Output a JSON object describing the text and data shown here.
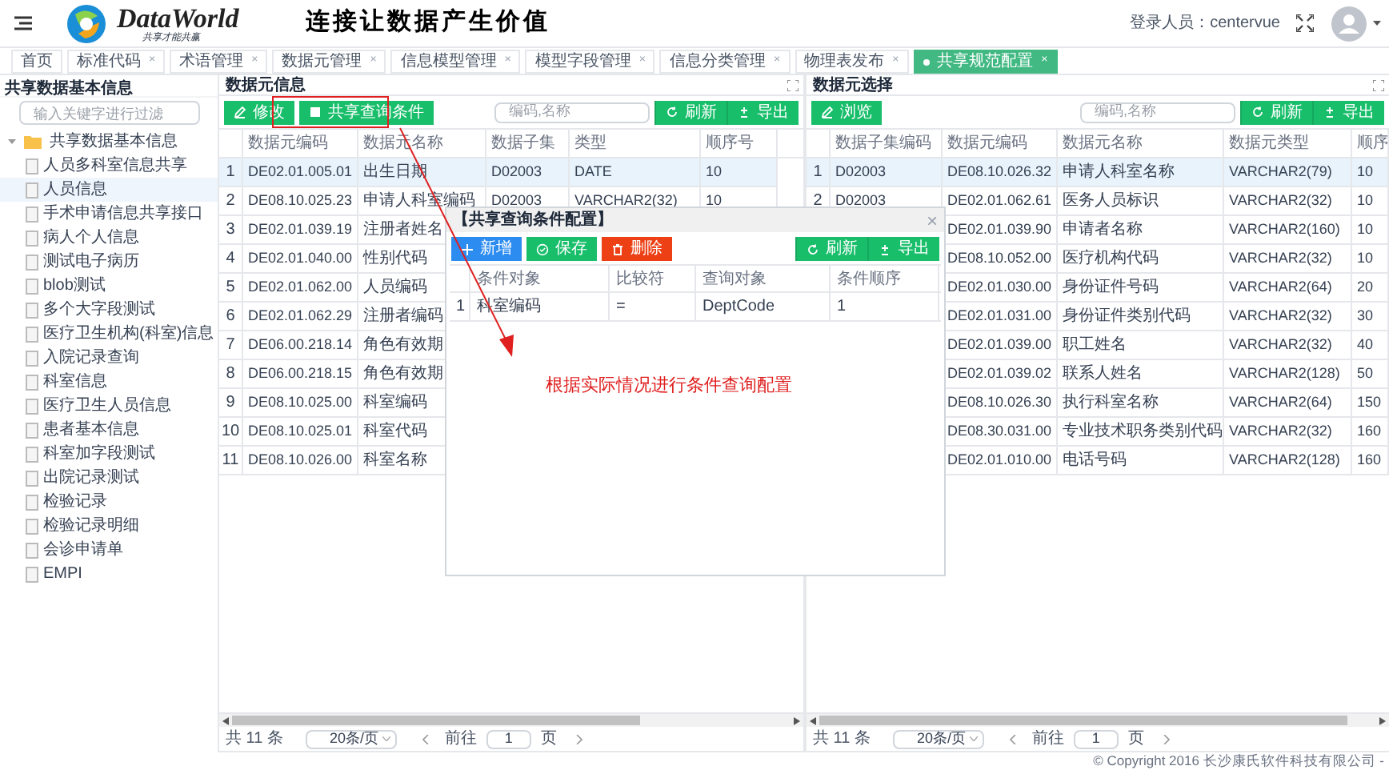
{
  "header": {
    "logo_text": "DataWorld",
    "logo_subtitle": "共享才能共赢",
    "slogan": "连接让数据产生价值",
    "login_label": "登录人员：centervue"
  },
  "tabs": [
    {
      "label": "首页",
      "selected": false
    },
    {
      "label": "标准代码",
      "close": "×",
      "selected": false
    },
    {
      "label": "术语管理",
      "close": "×",
      "selected": false
    },
    {
      "label": "数据元管理",
      "close": "×",
      "selected": false
    },
    {
      "label": "信息模型管理",
      "close": "×",
      "selected": false
    },
    {
      "label": "模型字段管理",
      "close": "×",
      "selected": false
    },
    {
      "label": "信息分类管理",
      "close": "×",
      "selected": false
    },
    {
      "label": "物理表发布",
      "close": "×",
      "selected": false
    },
    {
      "label": "共享规范配置",
      "close": "×",
      "selected": true
    }
  ],
  "sidebar": {
    "title": "共享数据基本信息",
    "filter_placeholder": "输入关键字进行过滤",
    "tree": [
      {
        "label": "共享数据基本信息",
        "expanded": true,
        "children": [
          {
            "label": "人员多科室信息共享",
            "selected": false
          },
          {
            "label": "人员信息",
            "selected": true
          },
          {
            "label": "手术申请信息共享接口",
            "selected": false
          },
          {
            "label": "病人个人信息",
            "selected": false
          },
          {
            "label": "测试电子病历",
            "selected": false
          },
          {
            "label": "blob测试",
            "selected": false
          },
          {
            "label": "多个大字段测试",
            "selected": false
          },
          {
            "label": "医疗卫生机构(科室)信息",
            "selected": false
          },
          {
            "label": "入院记录查询",
            "selected": false
          },
          {
            "label": "科室信息",
            "selected": false
          },
          {
            "label": "医疗卫生人员信息",
            "selected": false
          },
          {
            "label": "患者基本信息",
            "selected": false
          },
          {
            "label": "科室加字段测试",
            "selected": false
          },
          {
            "label": "出院记录测试",
            "selected": false
          },
          {
            "label": "检验记录",
            "selected": false
          },
          {
            "label": "检验记录明细",
            "selected": false
          },
          {
            "label": "会诊申请单",
            "selected": false
          },
          {
            "label": "EMPI",
            "selected": false
          }
        ]
      }
    ]
  },
  "panels": [
    {
      "title": "数据元信息",
      "buttons": [
        {
          "label": "修改",
          "kind": "edit"
        },
        {
          "label": "共享查询条件",
          "kind": "doc"
        }
      ],
      "search_placeholder": "编码,名称",
      "actions": [
        {
          "label": "刷新",
          "kind": "refresh"
        },
        {
          "label": "导出",
          "kind": "export"
        }
      ],
      "columns": [
        "数据元编码",
        "数据元名称",
        "数据子集",
        "类型",
        "顺序号"
      ],
      "rows": [
        {
          "selected": true,
          "number": "1",
          "cells": [
            "DE02.01.005.01",
            "出生日期",
            "D02003",
            "DATE",
            "10"
          ]
        },
        {
          "selected": false,
          "number": "2",
          "cells": [
            "DE08.10.025.23",
            "申请人科室编码",
            "D02003",
            "VARCHAR2(32)",
            "10"
          ]
        },
        {
          "selected": false,
          "number": "3",
          "cells": [
            "DE02.01.039.19",
            "注册者姓名"
          ]
        },
        {
          "selected": false,
          "number": "4",
          "cells": [
            "DE02.01.040.00",
            "性别代码"
          ]
        },
        {
          "selected": false,
          "number": "5",
          "cells": [
            "DE02.01.062.00",
            "人员编码"
          ]
        },
        {
          "selected": false,
          "number": "6",
          "cells": [
            "DE02.01.062.29",
            "注册者编码"
          ]
        },
        {
          "selected": false,
          "number": "7",
          "cells": [
            "DE06.00.218.14",
            "角色有效期"
          ]
        },
        {
          "selected": false,
          "number": "8",
          "cells": [
            "DE06.00.218.15",
            "角色有效期"
          ]
        },
        {
          "selected": false,
          "number": "9",
          "cells": [
            "DE08.10.025.00",
            "科室编码"
          ]
        },
        {
          "selected": false,
          "number": "10",
          "cells": [
            "DE08.10.025.01",
            "科室代码"
          ]
        },
        {
          "selected": false,
          "number": "11",
          "cells": [
            "DE08.10.026.00",
            "科室名称"
          ]
        }
      ],
      "pagination": {
        "total": "共 11 条",
        "page_size": "20条/页",
        "goto_label": "前往",
        "page": "1",
        "page_suffix": "页"
      }
    },
    {
      "title": "数据元选择",
      "buttons": [
        {
          "label": "浏览",
          "kind": "edit"
        }
      ],
      "search_placeholder": "编码,名称",
      "actions": [
        {
          "label": "刷新",
          "kind": "refresh"
        },
        {
          "label": "导出",
          "kind": "export"
        }
      ],
      "columns": [
        "数据子集编码",
        "数据元编码",
        "数据元名称",
        "数据元类型",
        "顺序"
      ],
      "rows": [
        {
          "selected": true,
          "number": "1",
          "cells": [
            "D02003",
            "DE08.10.026.32",
            "申请人科室名称",
            "VARCHAR2(79)",
            "10"
          ]
        },
        {
          "selected": false,
          "number": "2",
          "cells": [
            "D02003",
            "DE02.01.062.61",
            "医务人员标识",
            "VARCHAR2(32)",
            "10"
          ]
        },
        {
          "selected": false,
          "cells": [
            null,
            "DE02.01.039.90",
            "申请者名称",
            "VARCHAR2(160)",
            "10"
          ]
        },
        {
          "selected": false,
          "cells": [
            null,
            "DE08.10.052.00",
            "医疗机构代码",
            "VARCHAR2(32)",
            "10"
          ]
        },
        {
          "selected": false,
          "cells": [
            null,
            "DE02.01.030.00",
            "身份证件号码",
            "VARCHAR2(64)",
            "20"
          ]
        },
        {
          "selected": false,
          "cells": [
            null,
            "DE02.01.031.00",
            "身份证件类别代码",
            "VARCHAR2(32)",
            "30"
          ]
        },
        {
          "selected": false,
          "cells": [
            null,
            "DE02.01.039.00",
            "职工姓名",
            "VARCHAR2(32)",
            "40"
          ]
        },
        {
          "selected": false,
          "cells": [
            null,
            "DE02.01.039.02",
            "联系人姓名",
            "VARCHAR2(128)",
            "50"
          ]
        },
        {
          "selected": false,
          "cells": [
            null,
            "DE08.10.026.30",
            "执行科室名称",
            "VARCHAR2(64)",
            "150"
          ]
        },
        {
          "selected": false,
          "cells": [
            null,
            "DE08.30.031.00",
            "专业技术职务类别代码",
            "VARCHAR2(32)",
            "160"
          ]
        },
        {
          "selected": false,
          "cells": [
            null,
            "DE02.01.010.00",
            "电话号码",
            "VARCHAR2(128)",
            "160"
          ]
        }
      ],
      "pagination": {
        "total": "共 11 条",
        "page_size": "20条/页",
        "goto_label": "前往",
        "page": "1",
        "page_suffix": "页"
      }
    }
  ],
  "dialog": {
    "title": "【共享查询条件配置】",
    "close": "×",
    "buttons": [
      {
        "label": "新增",
        "kind": "add"
      },
      {
        "label": "保存",
        "kind": "save"
      },
      {
        "label": "删除",
        "kind": "delete"
      }
    ],
    "actions": [
      {
        "label": "刷新",
        "kind": "refresh"
      },
      {
        "label": "导出",
        "kind": "export"
      }
    ],
    "columns": [
      "条件对象",
      "比较符",
      "查询对象",
      "条件顺序"
    ],
    "rows": [
      {
        "number": "1",
        "cells": [
          "科室编码",
          "=",
          "DeptCode",
          "1"
        ]
      }
    ]
  },
  "annotation": {
    "text": "根据实际情况进行条件查询配置"
  },
  "footer": "© Copyright 2016 长沙康氏软件科技有限公司 -"
}
